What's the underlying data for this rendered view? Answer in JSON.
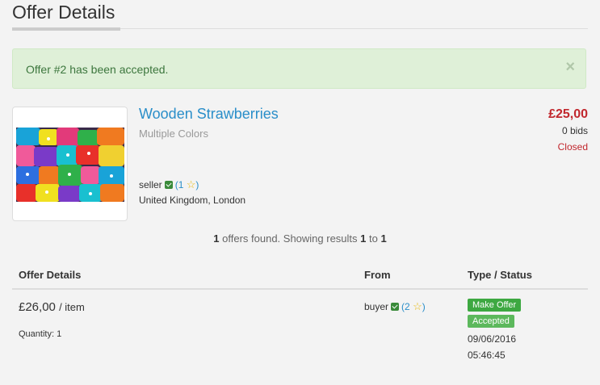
{
  "page": {
    "title": "Offer Details"
  },
  "alert": {
    "message": "Offer #2 has been accepted.",
    "close_glyph": "×"
  },
  "item": {
    "title": "Wooden Strawberries",
    "subtitle": "Multiple Colors",
    "price": "£25,00",
    "bids": "0 bids",
    "status": "Closed",
    "seller": {
      "name": "seller",
      "rating_open": "(",
      "rating": "1",
      "rating_close": ")"
    },
    "location": "United Kingdom, London"
  },
  "results": {
    "count": "1",
    "text_a": " offers found. Showing results ",
    "from": "1",
    "text_b": " to ",
    "to": "1"
  },
  "table": {
    "headers": {
      "details": "Offer Details",
      "from": "From",
      "type_status": "Type / Status"
    },
    "rows": [
      {
        "amount": "£26,00",
        "unit": "/ item",
        "quantity": "Quantity: 1",
        "buyer": {
          "name": "buyer",
          "rating_open": "(",
          "rating": "2",
          "rating_close": ")"
        },
        "type": "Make Offer",
        "status": "Accepted",
        "date": "09/06/2016",
        "time": "05:46:45"
      }
    ]
  },
  "colors": {
    "accent_link": "#2a8ec9",
    "price_red": "#c1272d",
    "success": "#3c763d",
    "badge_green": "#3da841"
  }
}
